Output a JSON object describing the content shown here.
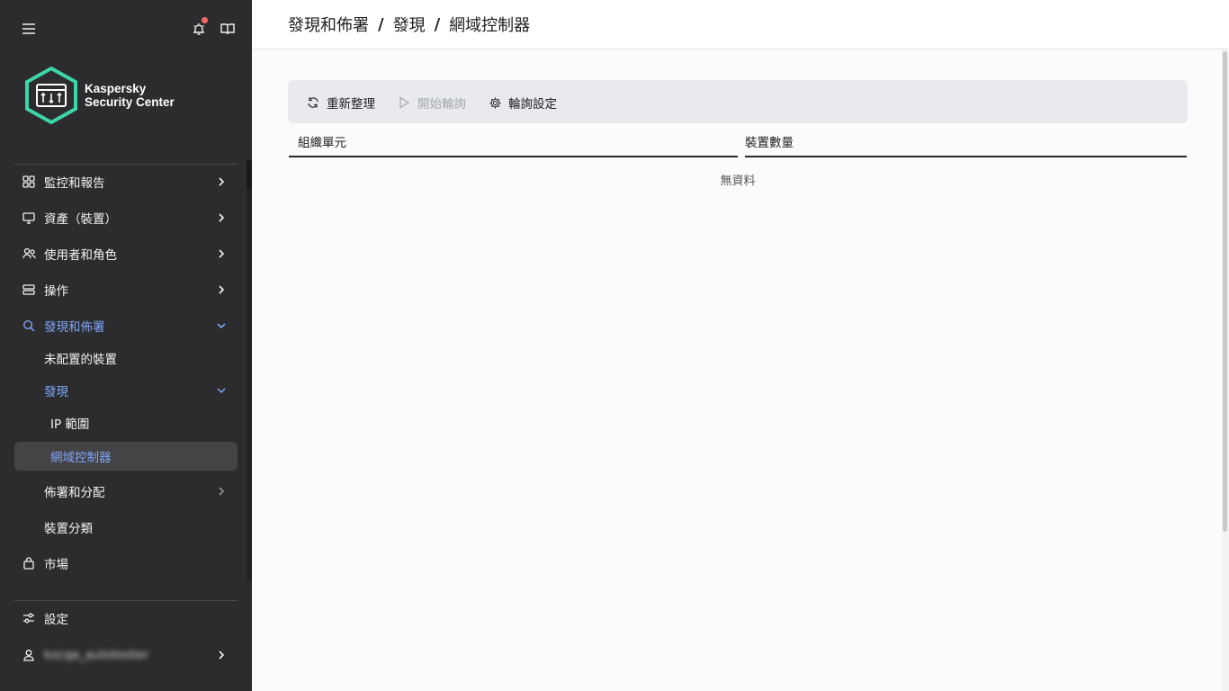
{
  "sidebar": {
    "logo": {
      "line1": "Kaspersky",
      "line2": "Security Center"
    },
    "top_icons": [
      "hamburger-menu-icon",
      "bell-icon",
      "book-icon"
    ],
    "items": [
      {
        "label": "監控和報告",
        "icon": "dashboard-icon"
      },
      {
        "label": "資產（裝置）",
        "icon": "monitor-icon"
      },
      {
        "label": "使用者和角色",
        "icon": "users-icon"
      },
      {
        "label": "操作",
        "icon": "server-icon"
      },
      {
        "label": "發現和佈署",
        "icon": "search-icon"
      },
      {
        "label": "未配置的裝置"
      },
      {
        "label": "發現"
      },
      {
        "label": "IP 範圍"
      },
      {
        "label": "網域控制器"
      },
      {
        "label": "佈署和分配"
      },
      {
        "label": "裝置分類"
      },
      {
        "label": "市場",
        "icon": "bag-icon"
      },
      {
        "label": "設定",
        "icon": "sliders-icon"
      },
      {
        "label": "kscqa_autotester",
        "icon": "user-icon"
      }
    ]
  },
  "breadcrumb": [
    "發現和佈署",
    "發現",
    "網域控制器"
  ],
  "breadcrumb_sep": "/",
  "toolbar": {
    "refresh": "重新整理",
    "start_polling": "開始輪詢",
    "polling_settings": "輪詢設定"
  },
  "table": {
    "columns": [
      "組織單元",
      "裝置數量"
    ],
    "empty_text": "無資料"
  },
  "colors": {
    "sidebar_bg": "#2c2c2e",
    "accent": "#7ea4f5",
    "logo_green": "#3dd6a8",
    "notification": "#f06a62"
  }
}
